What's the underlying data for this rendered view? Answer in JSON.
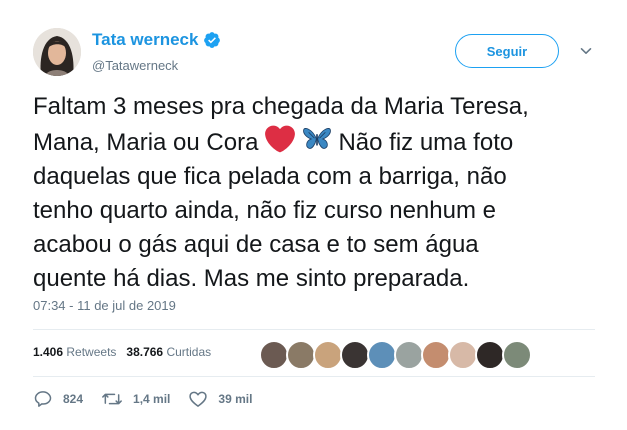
{
  "author": {
    "name": "Tata werneck",
    "handle": "@Tatawerneck",
    "verified": true
  },
  "follow_button": {
    "label": "Seguir"
  },
  "tweet": {
    "lines": [
      "Faltam 3 meses pra chegada da Maria Teresa,",
      "Mana, Maria ou Cora",
      "Não fiz uma foto",
      "daquelas que fica pelada com a barriga, não",
      "tenho quarto ainda, não fiz curso nenhum e",
      "acabou o gás aqui de casa e to sem água",
      "quente há dias. Mas me sinto preparada."
    ],
    "emojis": [
      "red-heart",
      "blue-butterfly"
    ]
  },
  "timestamp": "07:34 - 11 de jul de 2019",
  "stats": {
    "retweets_count": "1.406",
    "retweets_label": "Retweets",
    "likes_count": "38.766",
    "likes_label": "Curtidas"
  },
  "actions": {
    "replies": "824",
    "retweets": "1,4 mil",
    "likes": "39 mil"
  },
  "colors": {
    "brand_blue": "#1da1f2",
    "secondary_text": "#657786",
    "divider": "#e6ecf0",
    "heart_red": "#dd2e44",
    "butterfly_blue": "#3b88c3"
  }
}
